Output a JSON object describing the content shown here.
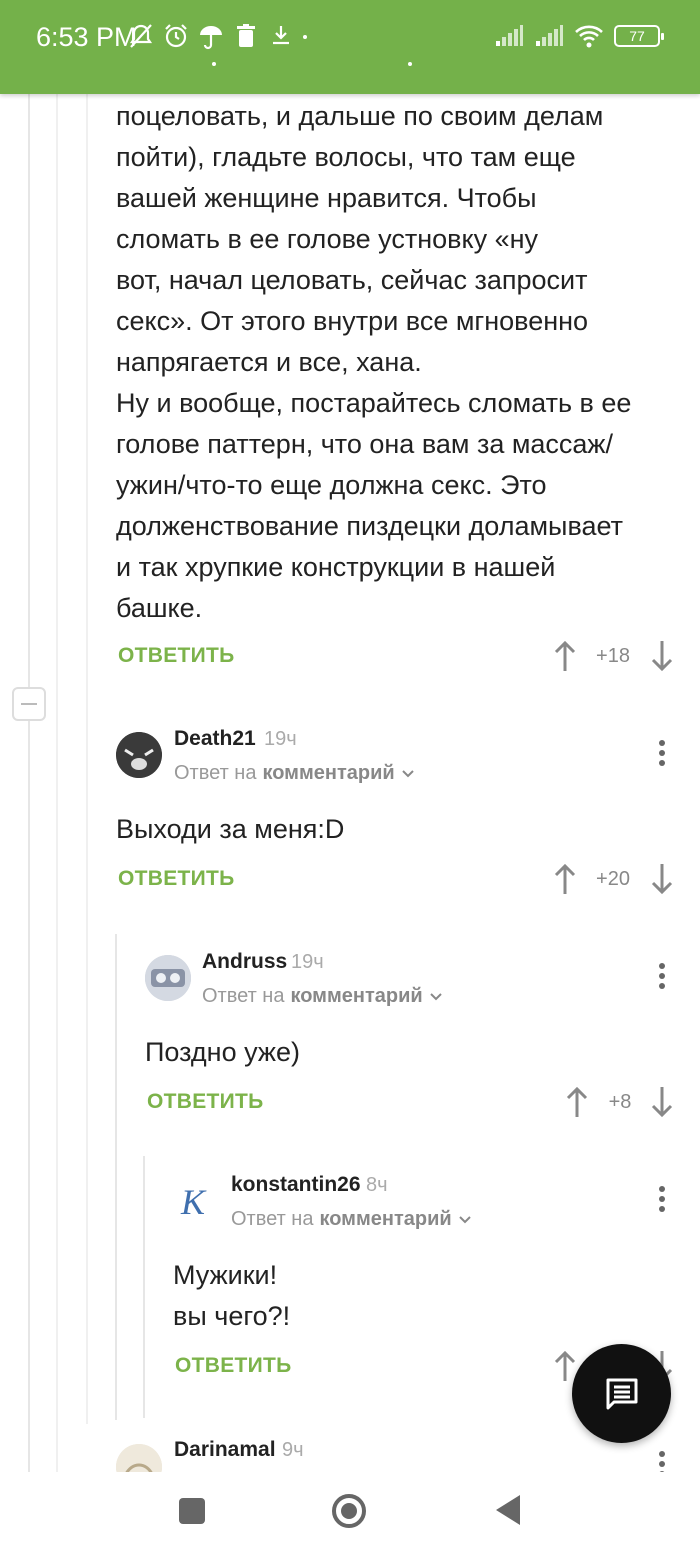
{
  "status_bar": {
    "time": "6:53 PM",
    "battery": "77",
    "left_icons": [
      "muted-bell-icon",
      "alarm-icon",
      "umbrella-icon",
      "trash-icon",
      "download-icon"
    ],
    "right_icons": [
      "signal-icon",
      "signal-icon",
      "wifi-icon",
      "battery-icon"
    ]
  },
  "parent_comment": {
    "text_lines": [
      "поцеловать, и дальше по своим делам",
      "пойти), гладьте волосы, что там еще",
      "вашей женщине нравится. Чтобы",
      "сломать в ее голове устновку «ну",
      "вот, начал целовать, сейчас запросит",
      "секс». От этого внутри все мгновенно",
      "напрягается и все, хана.",
      "Ну и вообще, постарайтесь сломать в ее",
      "голове паттерн, что она вам за массаж/",
      "ужин/что-то еще должна секс. Это",
      "долженствование пиздецки доламывает",
      "и так хрупкие конструкции в нашей",
      "башке."
    ],
    "reply_label": "ОТВЕТИТЬ",
    "score": "+18"
  },
  "comments": [
    {
      "username": "Death21",
      "time": "19ч",
      "reply_prefix": "Ответ на",
      "reply_target": "комментарий",
      "text_lines": [
        "Выходи за меня:D"
      ],
      "reply_label": "ОТВЕТИТЬ",
      "score": "+20"
    },
    {
      "username": "Andruss",
      "time": "19ч",
      "reply_prefix": "Ответ на",
      "reply_target": "комментарий",
      "text_lines": [
        "Поздно уже)"
      ],
      "reply_label": "ОТВЕТИТЬ",
      "score": "+8"
    },
    {
      "username": "konstantin26",
      "time": "8ч",
      "reply_prefix": "Ответ на",
      "reply_target": "комментарий",
      "text_lines": [
        "Мужики!",
        "вы чего?!"
      ],
      "reply_label": "ОТВЕТИТЬ",
      "score": ""
    },
    {
      "username": "Darinamal",
      "time": "9ч"
    }
  ],
  "fab_icon": "comment-icon",
  "nav_icons": [
    "recents-square-icon",
    "home-circle-icon",
    "back-triangle-icon"
  ],
  "colors": {
    "status_bar": "#74b14a",
    "accent": "#7cb34a",
    "fab": "#111111"
  }
}
